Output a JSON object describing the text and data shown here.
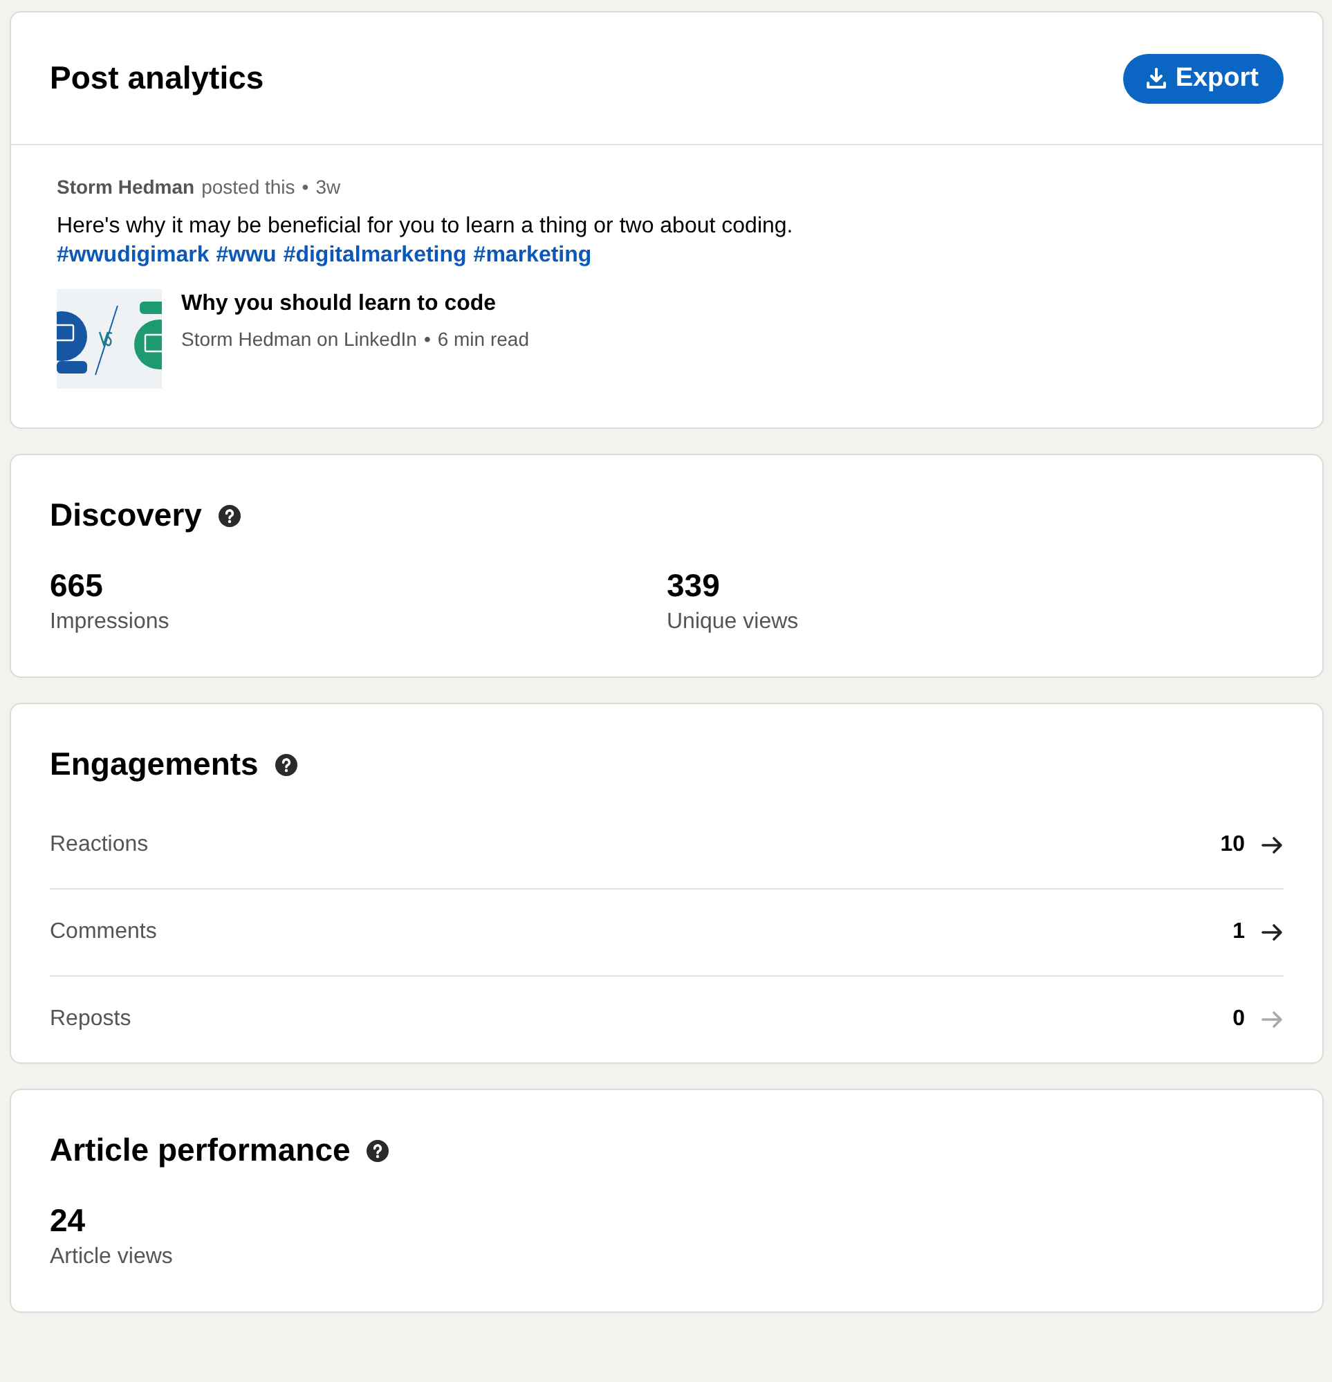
{
  "header": {
    "title": "Post analytics",
    "export_button": "Export"
  },
  "post": {
    "author": "Storm Hedman",
    "action": "posted this",
    "separator": "•",
    "age": "3w",
    "text": "Here's why it may be beneficial for you to learn a thing or two about coding.",
    "hashtags": [
      "#wwudigimark",
      "#wwu",
      "#digitalmarketing",
      "#marketing"
    ],
    "article": {
      "title": "Why you should learn to code",
      "source": "Storm Hedman on LinkedIn",
      "separator": "•",
      "read_time": "6 min read"
    }
  },
  "discovery": {
    "title": "Discovery",
    "metrics": [
      {
        "value": "665",
        "label": "Impressions"
      },
      {
        "value": "339",
        "label": "Unique views"
      }
    ]
  },
  "engagements": {
    "title": "Engagements",
    "rows": [
      {
        "label": "Reactions",
        "count": "10",
        "disabled": false
      },
      {
        "label": "Comments",
        "count": "1",
        "disabled": false
      },
      {
        "label": "Reposts",
        "count": "0",
        "disabled": true
      }
    ]
  },
  "article_performance": {
    "title": "Article performance",
    "metrics": [
      {
        "value": "24",
        "label": "Article views"
      }
    ]
  }
}
